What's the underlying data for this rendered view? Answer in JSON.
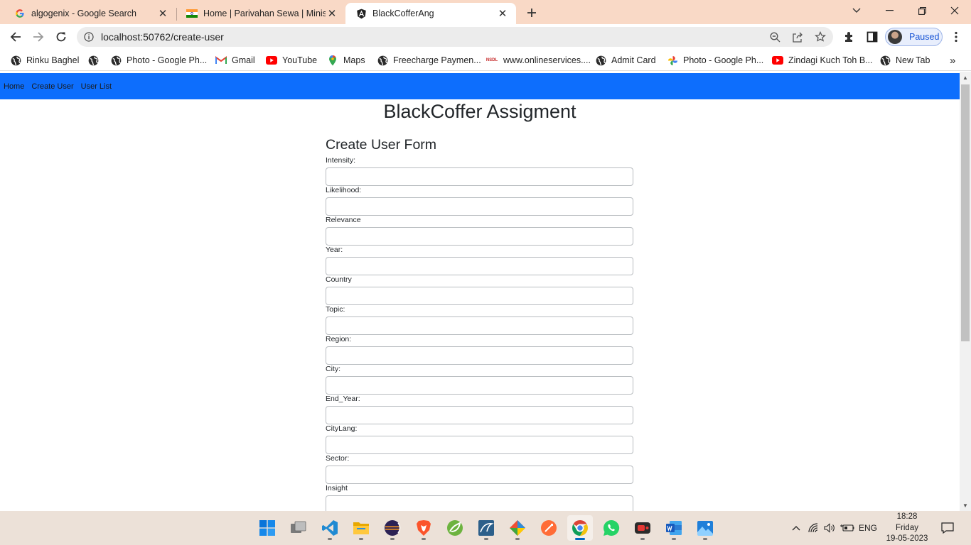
{
  "tabs": [
    {
      "title": "algogenix - Google Search",
      "icon": "google-icon"
    },
    {
      "title": "Home | Parivahan Sewa | Ministry",
      "icon": "india-flag-icon"
    },
    {
      "title": "BlackCofferAng",
      "icon": "angular-icon",
      "active": true
    }
  ],
  "address_bar": {
    "url": "localhost:50762/create-user"
  },
  "profile": {
    "label": "Paused"
  },
  "bookmarks": [
    {
      "label": "Rinku Baghel",
      "icon": "globe-icon"
    },
    {
      "label": "",
      "icon": "globe-icon"
    },
    {
      "label": "Photo - Google Ph...",
      "icon": "globe-icon"
    },
    {
      "label": "Gmail",
      "icon": "gmail-icon"
    },
    {
      "label": "YouTube",
      "icon": "youtube-icon"
    },
    {
      "label": "Maps",
      "icon": "maps-icon"
    },
    {
      "label": "Freecharge Paymen...",
      "icon": "globe-icon"
    },
    {
      "label": "www.onlineservices....",
      "icon": "nsdl-icon",
      "icon_text": "NSDL"
    },
    {
      "label": "Admit Card",
      "icon": "globe-icon"
    },
    {
      "label": "Photo - Google Ph...",
      "icon": "google-photos-icon"
    },
    {
      "label": "Zindagi Kuch Toh B...",
      "icon": "youtube-icon"
    },
    {
      "label": "New Tab",
      "icon": "globe-icon"
    }
  ],
  "app": {
    "nav": [
      "Home",
      "Create User",
      "User List"
    ],
    "heading": "BlackCoffer Assigment",
    "form_title": "Create User Form",
    "fields": [
      {
        "label": "Intensity:",
        "value": ""
      },
      {
        "label": "Likelihood:",
        "value": ""
      },
      {
        "label": "Relevance",
        "value": ""
      },
      {
        "label": "Year:",
        "value": ""
      },
      {
        "label": "Country",
        "value": ""
      },
      {
        "label": "Topic:",
        "value": ""
      },
      {
        "label": "Region:",
        "value": ""
      },
      {
        "label": "City:",
        "value": ""
      },
      {
        "label": "End_Year:",
        "value": ""
      },
      {
        "label": "CityLang:",
        "value": ""
      },
      {
        "label": "Sector:",
        "value": ""
      },
      {
        "label": "Insight",
        "value": ""
      }
    ]
  },
  "taskbar": {
    "apps": [
      "windows-start-icon",
      "task-view-icon",
      "vscode-icon",
      "file-explorer-icon",
      "eclipse-icon",
      "brave-icon",
      "spring-tools-icon",
      "mysql-workbench-icon",
      "git-gui-icon",
      "postman-icon",
      "chrome-icon",
      "whatsapp-icon",
      "screen-recorder-icon",
      "word-icon",
      "photos-icon"
    ],
    "active_app": "chrome-icon",
    "language": "ENG",
    "time": "18:28",
    "day": "Friday",
    "date": "19-05-2023"
  },
  "colors": {
    "tabstrip": "#f9d9c6",
    "app_nav": "#0d6efd",
    "taskbar": "#ece1d8"
  }
}
